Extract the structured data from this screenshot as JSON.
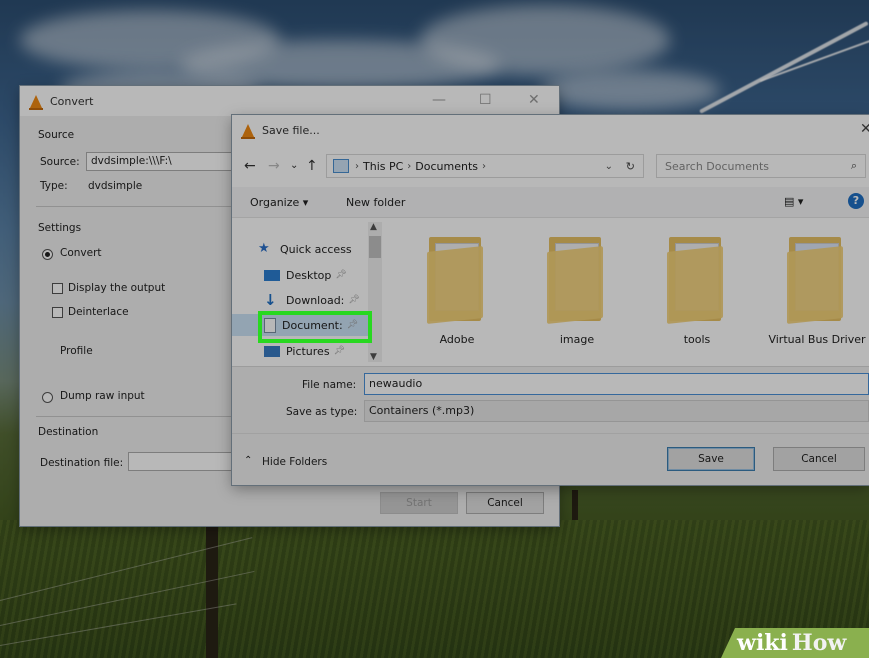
{
  "convert_window": {
    "title": "Convert",
    "source_section": "Source",
    "source_label": "Source:",
    "source_value": "dvdsimple:\\\\\\F:\\",
    "type_label": "Type:",
    "type_value": "dvdsimple",
    "settings_section": "Settings",
    "convert_radio": "Convert",
    "display_output": "Display the output",
    "deinterlace": "Deinterlace",
    "profile_label": "Profile",
    "dump_raw": "Dump raw input",
    "destination_section": "Destination",
    "destination_file_label": "Destination file:",
    "start_button": "Start",
    "cancel_button": "Cancel"
  },
  "save_dialog": {
    "title": "Save file...",
    "breadcrumbs": [
      "This PC",
      "Documents"
    ],
    "search_placeholder": "Search Documents",
    "organize": "Organize ▾",
    "new_folder": "New folder",
    "nav_items": [
      {
        "label": "Quick access",
        "icon": "star-icon"
      },
      {
        "label": "Desktop",
        "icon": "desktop-icon"
      },
      {
        "label": "Download:",
        "icon": "download-icon"
      },
      {
        "label": "Document:",
        "icon": "document-icon"
      },
      {
        "label": "Pictures",
        "icon": "pictures-icon"
      }
    ],
    "folders": [
      "Adobe",
      "image",
      "tools",
      "Virtual Bus Driver"
    ],
    "file_name_label": "File name:",
    "file_name_value": "newaudio",
    "save_as_type_label": "Save as type:",
    "save_as_type_value": "Containers (*.mp3)",
    "hide_folders": "Hide Folders",
    "save_button": "Save",
    "cancel_button": "Cancel"
  },
  "watermark": {
    "wiki": "wiki",
    "how": "How"
  },
  "colors": {
    "highlight": "#28d820",
    "vlc_orange": "#f08a12",
    "wikihow_green": "#8ab04e"
  }
}
